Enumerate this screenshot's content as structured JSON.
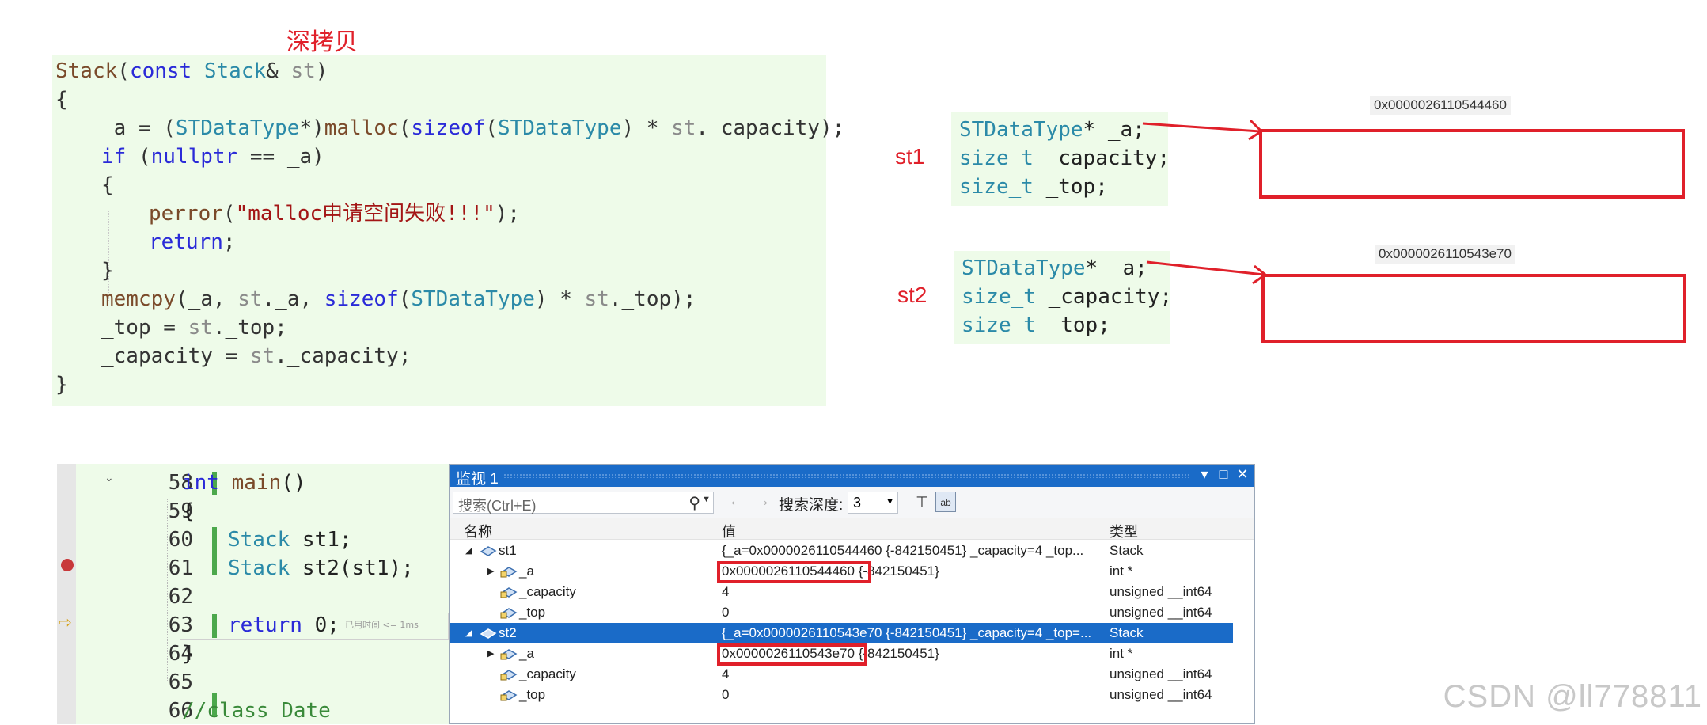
{
  "top": {
    "title": "深拷贝",
    "code": [
      "Stack(const Stack& st)",
      "{",
      "_a = (STDataType*)malloc(sizeof(STDataType) * st._capacity);",
      "if (nullptr == _a)",
      "{",
      "perror(\"malloc申请空间失败!!!\");",
      "return;",
      "}",
      "memcpy(_a, st._a, sizeof(STDataType) * st._top);",
      "_top = st._top;",
      "_capacity = st._capacity;",
      "}"
    ]
  },
  "diagram": {
    "objects": [
      {
        "label": "st1",
        "fields": [
          "STDataType* _a;",
          "size_t _capacity;",
          "size_t _top;"
        ],
        "address": "0x0000026110544460"
      },
      {
        "label": "st2",
        "fields": [
          "STDataType* _a;",
          "size_t _capacity;",
          "size_t _top;"
        ],
        "address": "0x0000026110543e70"
      }
    ]
  },
  "editor": {
    "lines": [
      {
        "num": "58",
        "code": "int main()"
      },
      {
        "num": "59",
        "code": "{"
      },
      {
        "num": "60",
        "code": "Stack st1;"
      },
      {
        "num": "61",
        "code": "Stack st2(st1);"
      },
      {
        "num": "62",
        "code": ""
      },
      {
        "num": "63",
        "code": "return 0;"
      },
      {
        "num": "64",
        "code": "}"
      },
      {
        "num": "65",
        "code": ""
      },
      {
        "num": "66",
        "code": "//class Date"
      }
    ],
    "elapsed": "已用时间 <= 1ms"
  },
  "watch": {
    "title": "监视 1",
    "search_placeholder": "搜索(Ctrl+E)",
    "depth_label": "搜索深度:",
    "depth_value": "3",
    "columns": [
      "名称",
      "值",
      "类型"
    ],
    "rows": [
      {
        "name": "st1",
        "value": "{_a=0x0000026110544460 {-842150451} _capacity=4 _top...",
        "type": "Stack"
      },
      {
        "name": "_a",
        "value_addr": "0x0000026110544460",
        "value_rest": " {-842150451}",
        "type": "int *"
      },
      {
        "name": "_capacity",
        "value": "4",
        "type": "unsigned __int64"
      },
      {
        "name": "_top",
        "value": "0",
        "type": "unsigned __int64"
      },
      {
        "name": "st2",
        "value": "{_a=0x0000026110543e70 {-842150451} _capacity=4 _top=...",
        "type": "Stack"
      },
      {
        "name": "_a",
        "value_addr": "0x0000026110543e70",
        "value_rest": " {-842150451}",
        "type": "int *"
      },
      {
        "name": "_capacity",
        "value": "4",
        "type": "unsigned __int64"
      },
      {
        "name": "_top",
        "value": "0",
        "type": "unsigned __int64"
      }
    ]
  },
  "watermark": "CSDN @ll778811",
  "colors": {
    "highlight": "#e0202a",
    "selection": "#1a6bc8",
    "code_bg": "#eefbe9"
  }
}
